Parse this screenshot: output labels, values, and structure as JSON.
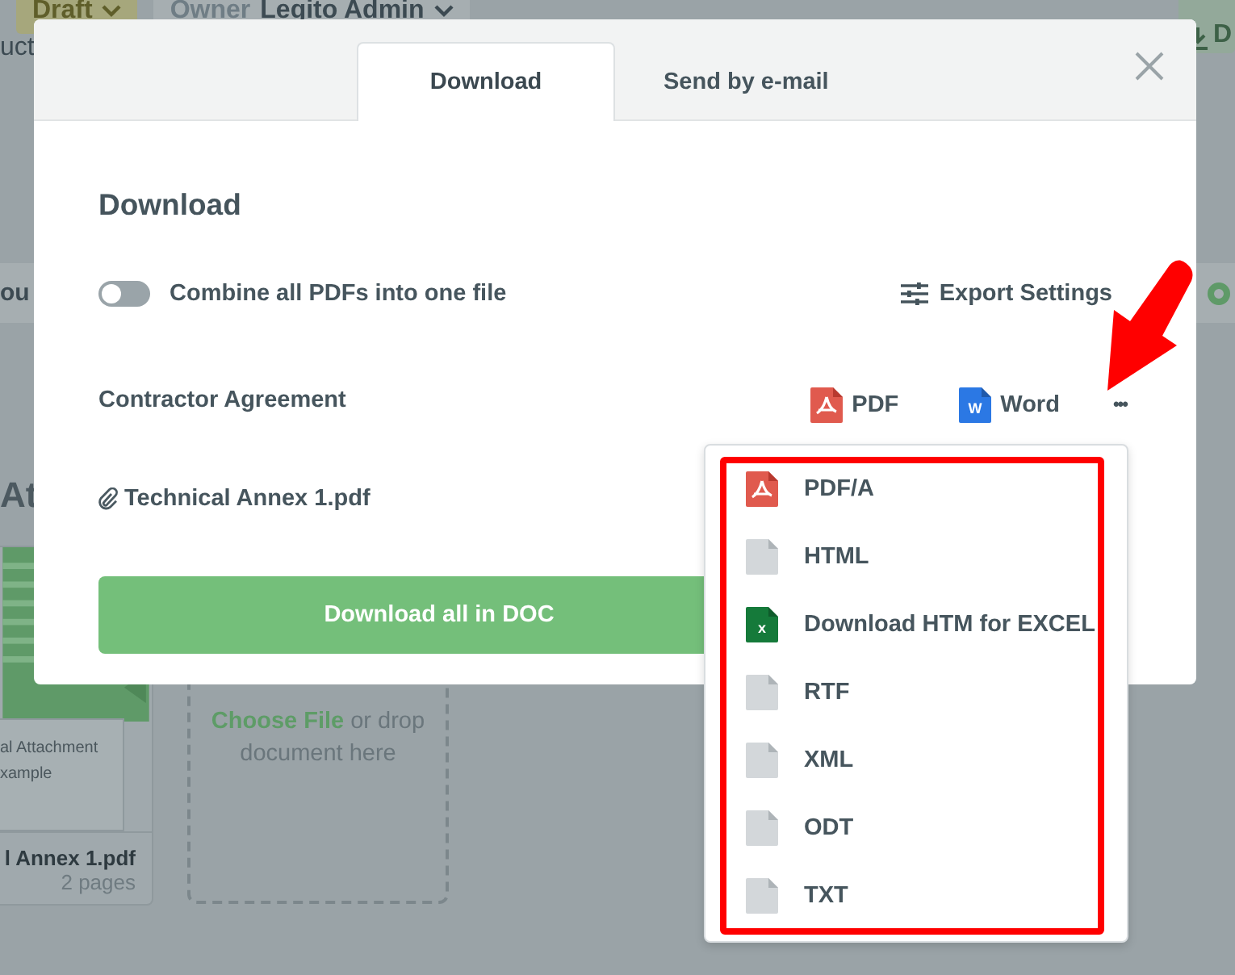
{
  "background": {
    "status_chip": "Draft",
    "owner_chip": {
      "label": "Owner",
      "value": "Legito Admin"
    },
    "top_right_button": "D",
    "cut_text_top": "uct",
    "cut_text_band": "ou",
    "section_heading": "At",
    "attachment_card": {
      "preview_lines": [
        "al Attachment",
        "xample"
      ],
      "file_name": "l Annex 1.pdf",
      "pages": "2 pages"
    },
    "drop_zone": {
      "link": "Choose File",
      "text": "or drop document here"
    }
  },
  "dialog": {
    "tabs": [
      {
        "label": "Download",
        "selected": true
      },
      {
        "label": "Send by e-mail",
        "selected": false
      }
    ],
    "heading": "Download",
    "combine_toggle": {
      "label": "Combine all PDFs into one file",
      "on": false
    },
    "export_settings": "Export Settings",
    "documents": [
      {
        "name": "Contractor Agreement",
        "attachment": false,
        "formats": [
          {
            "kind": "pdf",
            "label": "PDF"
          },
          {
            "kind": "word",
            "label": "Word",
            "badge": "W"
          }
        ],
        "more": "•••"
      },
      {
        "name": "Technical Annex 1.pdf",
        "attachment": true
      }
    ],
    "download_all": "Download all in DOC"
  },
  "format_menu": {
    "items": [
      {
        "kind": "pdf",
        "label": "PDF/A"
      },
      {
        "kind": "file",
        "label": "HTML"
      },
      {
        "kind": "excel",
        "label": "Download HTM for EXCEL",
        "badge": "x"
      },
      {
        "kind": "file",
        "label": "RTF"
      },
      {
        "kind": "file",
        "label": "XML"
      },
      {
        "kind": "file",
        "label": "ODT"
      },
      {
        "kind": "file",
        "label": "TXT"
      }
    ]
  }
}
